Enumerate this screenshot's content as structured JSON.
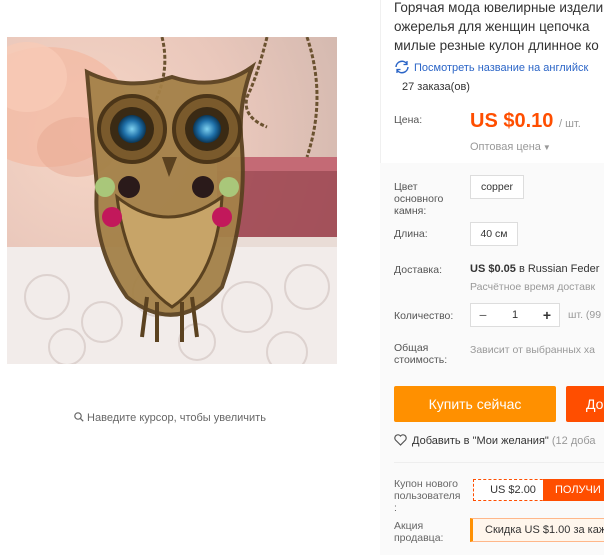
{
  "product": {
    "title_lines": [
      "Горячая мода ювелирные издели",
      "ожерелья для женщин цепочка",
      "милые резные кулон длинное ко"
    ],
    "translate_link": "Посмотреть название на английск",
    "orders": "27 заказа(ов)"
  },
  "gallery": {
    "zoom_hint": "Наведите курсор, чтобы увеличить"
  },
  "price": {
    "label": "Цена:",
    "value": "US $0.10",
    "unit": "/ шт.",
    "wholesale": "Оптовая цена"
  },
  "options": {
    "color_label_lines": [
      "Цвет",
      "основного",
      "камня:"
    ],
    "color_value": "copper",
    "length_label": "Длина:",
    "length_value": "40 см"
  },
  "shipping": {
    "label": "Доставка:",
    "price": "US $0.05",
    "method": "в Russian Feder",
    "estimate": "Расчётное время доставк"
  },
  "quantity": {
    "label": "Количество:",
    "minus": "−",
    "value": "1",
    "plus": "+",
    "unit": "шт. (99"
  },
  "total": {
    "label_lines": [
      "Общая",
      "стоимость:"
    ],
    "value": "Зависит от выбранных ха"
  },
  "actions": {
    "buy_now": "Купить сейчас",
    "add_to_cart": "До",
    "wishlist": "Добавить в \"Мои желания\"",
    "wishlist_count": "(12 доба"
  },
  "coupon": {
    "label_lines": [
      "Купон нового",
      "пользователя",
      ":"
    ],
    "value": "US $2.00",
    "get": "ПОЛУЧИ"
  },
  "promo": {
    "label_lines": [
      "Акция",
      "продавца:"
    ],
    "text": "Скидка US $1.00 за каж"
  },
  "colors": {
    "price_orange": "#ff4e00",
    "buy_button": "#ff9000",
    "cart_button": "#ff4e00",
    "link_blue": "#2b65c7"
  }
}
